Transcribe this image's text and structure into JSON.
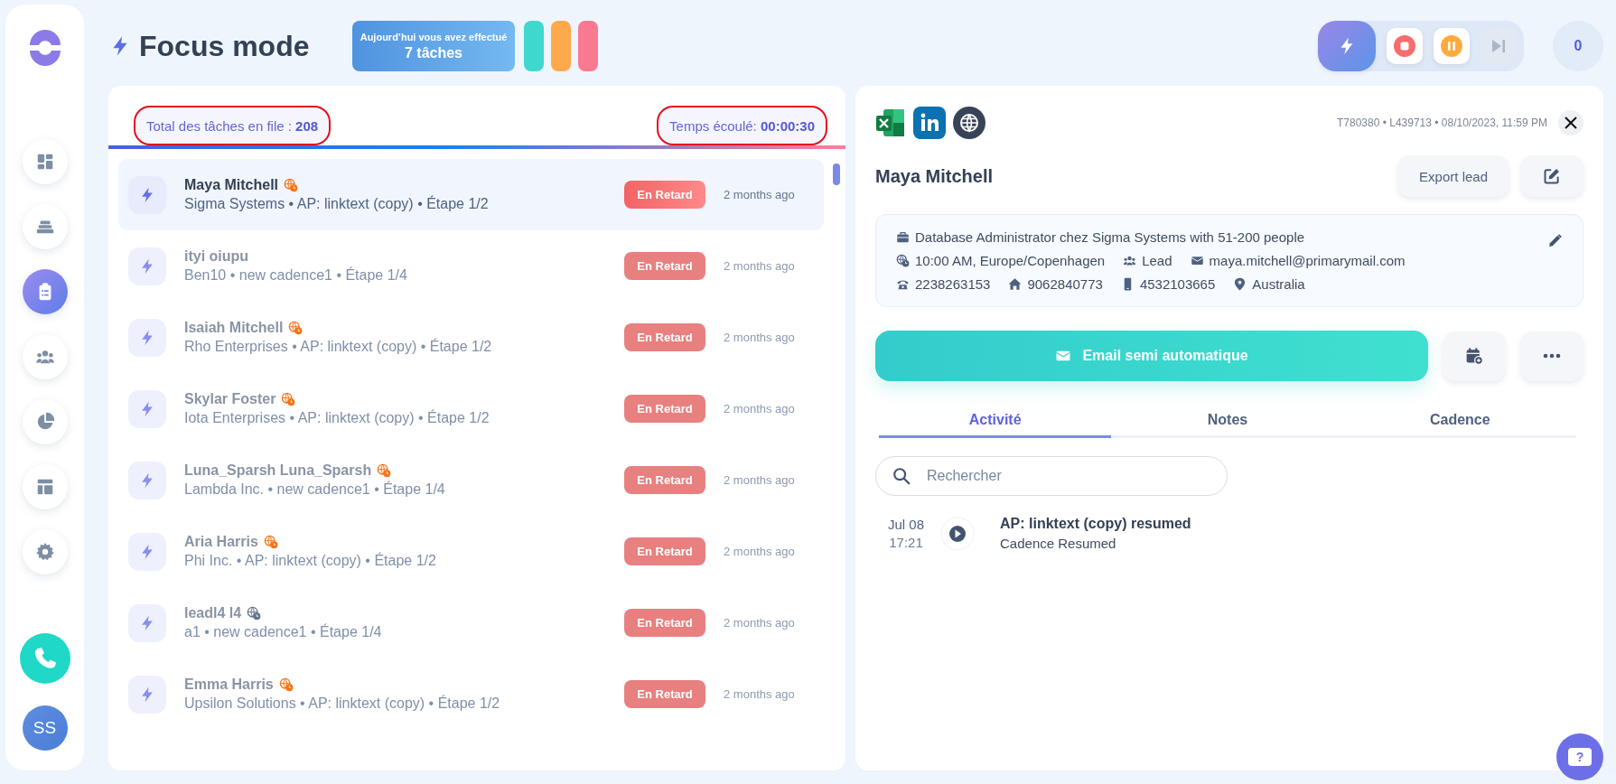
{
  "sidebar": {
    "items": [
      {
        "selected": false
      },
      {
        "selected": false
      },
      {
        "selected": true
      },
      {
        "selected": false
      },
      {
        "selected": false
      },
      {
        "selected": false
      },
      {
        "selected": false
      }
    ],
    "avatar": "SS"
  },
  "help_label": "?",
  "header": {
    "title": "Focus mode",
    "summary": {
      "line1": "Aujourd’hui vous avez effectué",
      "line2": "7 tâches"
    },
    "pills": [
      {
        "color": "#3fd8cf"
      },
      {
        "color": "#ffa94d"
      },
      {
        "color": "#f97a90"
      }
    ],
    "counter": "0",
    "controls": [
      {
        "kind": "focus",
        "disabled": false
      },
      {
        "kind": "stop",
        "disabled": false
      },
      {
        "kind": "pause",
        "disabled": false
      },
      {
        "kind": "skip",
        "disabled": true
      }
    ]
  },
  "queue": {
    "stats": [
      {
        "label": "Total des tâches en file : ",
        "value": "208",
        "outlined": true
      },
      {
        "label": "Temps écoulé: ",
        "value": "00:00:30",
        "outlined": true
      }
    ],
    "rows": [
      {
        "name": "Maya Mitchell",
        "subtitle": "Sigma Systems • AP: linktext (copy) • Étape 1/2",
        "status": "En Retard",
        "time": "2 months ago",
        "color": "#f97316",
        "selected": true
      },
      {
        "name": "ityi oiupu",
        "subtitle": "Ben10 • new cadence1 • Étape 1/4",
        "status": "En Retard",
        "time": "2 months ago",
        "selected": false
      },
      {
        "name": "Isaiah Mitchell",
        "subtitle": "Rho Enterprises • AP: linktext (copy) • Étape 1/2",
        "status": "En Retard",
        "time": "2 months ago",
        "color": "#f97316",
        "selected": false
      },
      {
        "name": "Skylar Foster",
        "subtitle": "Iota Enterprises • AP: linktext (copy) • Étape 1/2",
        "status": "En Retard",
        "time": "2 months ago",
        "color": "#f97316",
        "selected": false
      },
      {
        "name": "Luna_Sparsh Luna_Sparsh",
        "subtitle": "Lambda Inc. • new cadence1 • Étape 1/4",
        "status": "En Retard",
        "time": "2 months ago",
        "color": "#f97316",
        "selected": false
      },
      {
        "name": "Aria Harris",
        "subtitle": "Phi Inc. • AP: linktext (copy) • Étape 1/2",
        "status": "En Retard",
        "time": "2 months ago",
        "color": "#f97316",
        "selected": false
      },
      {
        "name": "leadl4 l4",
        "subtitle": "a1 • new cadence1 • Étape 1/4",
        "status": "En Retard",
        "time": "2 months ago",
        "color": "#64748b",
        "selected": false
      },
      {
        "name": "Emma Harris",
        "subtitle": "Upsilon Solutions • AP: linktext (copy) • Étape 1/2",
        "status": "En Retard",
        "time": "2 months ago",
        "color": "#f97316",
        "selected": false
      }
    ]
  },
  "lead": {
    "meta": "T780380 • L439713 • 08/10/2023, 11:59 PM",
    "name": "Maya Mitchell",
    "export_label": "Export lead",
    "info": [
      [
        {
          "kind": "job",
          "text": "Database Administrator chez Sigma Systems with 51-200 people"
        }
      ],
      [
        {
          "kind": "timezone",
          "text": "10:00 AM, Europe/Copenhagen"
        },
        {
          "kind": "role",
          "text": "Lead"
        },
        {
          "kind": "email",
          "text": "maya.mitchell@primarymail.com"
        }
      ],
      [
        {
          "kind": "phone",
          "text": "2238263153"
        },
        {
          "kind": "home",
          "text": "9062840773"
        },
        {
          "kind": "mobile",
          "text": "4532103665"
        },
        {
          "kind": "location",
          "text": "Australia"
        }
      ]
    ],
    "primary_action": "Email semi automatique",
    "tabs": [
      {
        "label": "Activité",
        "selected": true
      },
      {
        "label": "Notes",
        "selected": false
      },
      {
        "label": "Cadence",
        "selected": false
      }
    ],
    "search": {
      "placeholder": "Rechercher"
    },
    "activities": [
      {
        "date": "Jul 08",
        "time": "17:21",
        "title": "AP: linktext (copy) resumed",
        "detail": "Cadence Resumed"
      }
    ]
  }
}
